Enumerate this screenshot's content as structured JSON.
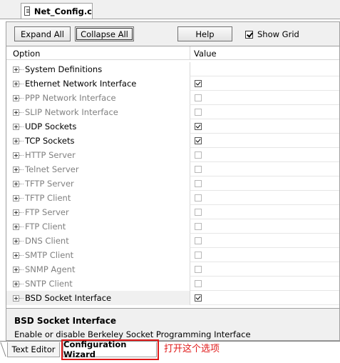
{
  "document_tab": {
    "title": "Net_Config.c"
  },
  "toolbar": {
    "expand_all": "Expand All",
    "collapse_all": "Collapse All",
    "help": "Help",
    "show_grid_label": "Show Grid",
    "show_grid_checked": true
  },
  "grid": {
    "col_option": "Option",
    "col_value": "Value",
    "rows": [
      {
        "label": "System Definitions",
        "enabled": true,
        "has_checkbox": false,
        "checked": false
      },
      {
        "label": "Ethernet Network Interface",
        "enabled": true,
        "has_checkbox": true,
        "checked": true
      },
      {
        "label": "PPP Network Interface",
        "enabled": false,
        "has_checkbox": true,
        "checked": false
      },
      {
        "label": "SLIP Network Interface",
        "enabled": false,
        "has_checkbox": true,
        "checked": false
      },
      {
        "label": "UDP Sockets",
        "enabled": true,
        "has_checkbox": true,
        "checked": true
      },
      {
        "label": "TCP Sockets",
        "enabled": true,
        "has_checkbox": true,
        "checked": true
      },
      {
        "label": "HTTP Server",
        "enabled": false,
        "has_checkbox": true,
        "checked": false
      },
      {
        "label": "Telnet Server",
        "enabled": false,
        "has_checkbox": true,
        "checked": false
      },
      {
        "label": "TFTP Server",
        "enabled": false,
        "has_checkbox": true,
        "checked": false
      },
      {
        "label": "TFTP Client",
        "enabled": false,
        "has_checkbox": true,
        "checked": false
      },
      {
        "label": "FTP Server",
        "enabled": false,
        "has_checkbox": true,
        "checked": false
      },
      {
        "label": "FTP Client",
        "enabled": false,
        "has_checkbox": true,
        "checked": false
      },
      {
        "label": "DNS Client",
        "enabled": false,
        "has_checkbox": true,
        "checked": false
      },
      {
        "label": "SMTP Client",
        "enabled": false,
        "has_checkbox": true,
        "checked": false
      },
      {
        "label": "SNMP Agent",
        "enabled": false,
        "has_checkbox": true,
        "checked": false
      },
      {
        "label": "SNTP Client",
        "enabled": false,
        "has_checkbox": true,
        "checked": false
      },
      {
        "label": "BSD Socket Interface",
        "enabled": true,
        "has_checkbox": true,
        "checked": true,
        "selected": true
      }
    ]
  },
  "description": {
    "title": "BSD Socket Interface",
    "text": "Enable or disable Berkeley Socket Programming Interface"
  },
  "bottom_tabs": {
    "text_editor": "Text Editor",
    "configuration_wizard": "Configuration Wizard"
  },
  "annotation": {
    "text": "打开这个选项",
    "color": "#e01a1a"
  }
}
